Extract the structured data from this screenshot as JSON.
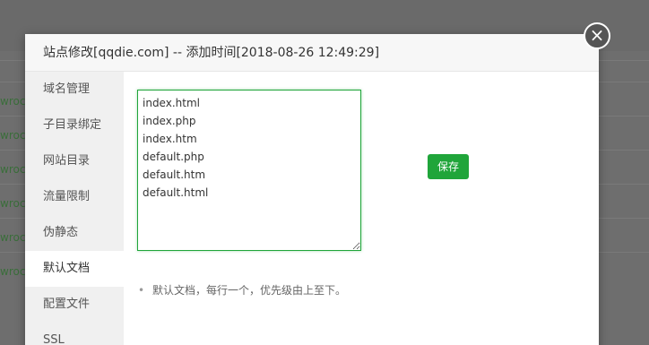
{
  "background": {
    "rows": [
      "wroc",
      "wroc",
      "wroc",
      "wroc",
      "wroc",
      "wroc"
    ]
  },
  "modal": {
    "title": "站点修改[qqdie.com] -- 添加时间[2018-08-26 12:49:29]",
    "close_symbol": "×"
  },
  "sidebar": {
    "items": [
      {
        "label": "域名管理"
      },
      {
        "label": "子目录绑定"
      },
      {
        "label": "网站目录"
      },
      {
        "label": "流量限制"
      },
      {
        "label": "伪静态"
      },
      {
        "label": "默认文档"
      },
      {
        "label": "配置文件"
      },
      {
        "label": "SSL"
      }
    ],
    "active_index": 5
  },
  "content": {
    "default_documents": "index.html\nindex.php\nindex.htm\ndefault.php\ndefault.htm\ndefault.html",
    "save_label": "保存",
    "help_items": [
      "默认文档，每行一个，优先级由上至下。"
    ]
  },
  "colors": {
    "accent": "#20a53a",
    "overlay": "#6e6e6e"
  }
}
